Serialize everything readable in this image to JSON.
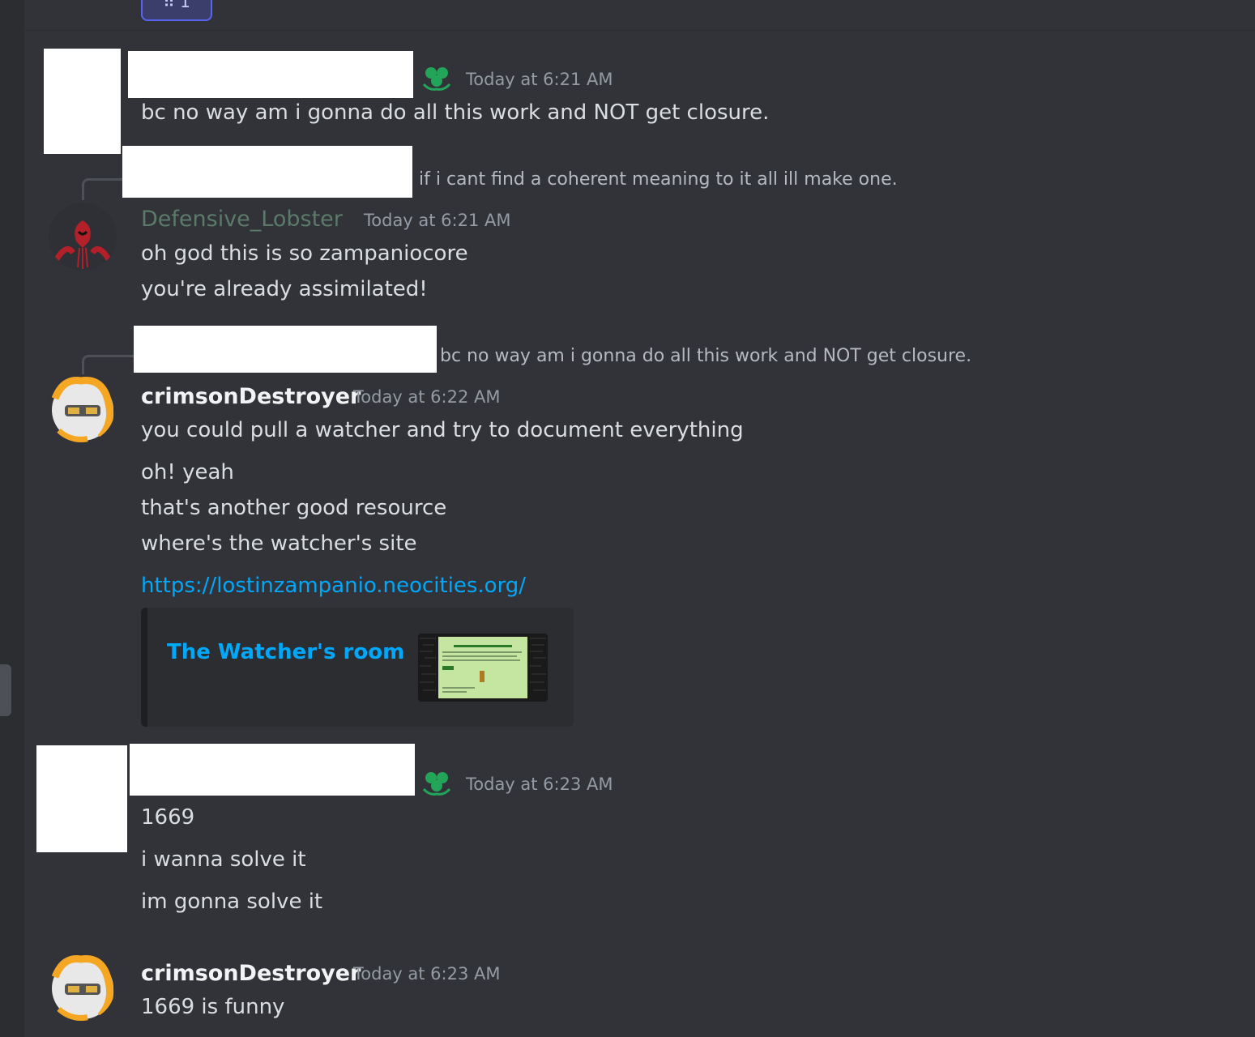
{
  "reaction": {
    "label": "⠿ 1"
  },
  "colors": {
    "background": "#313338",
    "link": "#00a8fc",
    "muted_name": "#5c7a6a",
    "badge": "#23a559"
  },
  "messages": [
    {
      "timestamp": "Today at 6:21 AM",
      "lines": [
        "bc no way am i gonna do all this work and NOT get closure."
      ]
    },
    {
      "reply_to": "if i cant find a coherent meaning to it all ill make one.",
      "author": "Defensive_Lobster",
      "timestamp": "Today at 6:21 AM",
      "lines": [
        "oh god this is so zampaniocore",
        "you're already assimilated!"
      ]
    },
    {
      "reply_to": "bc no way am i gonna do all this work and NOT get closure.",
      "author": "crimsonDestroyer",
      "timestamp": "Today at 6:22 AM",
      "lines": [
        "you could pull a watcher and try to document everything"
      ]
    },
    {
      "lines": [
        "oh! yeah",
        "that's another good resource",
        "where's the watcher's site"
      ],
      "link": "https://lostinzampanio.neocities.org/",
      "embed": {
        "title": "The Watcher's room"
      }
    },
    {
      "timestamp": "Today at 6:23 AM",
      "lines": [
        "1669",
        "i wanna solve it",
        "im gonna solve it"
      ]
    },
    {
      "author": "crimsonDestroyer",
      "timestamp": "Today at 6:23 AM",
      "lines": [
        "1669 is funny"
      ]
    }
  ]
}
